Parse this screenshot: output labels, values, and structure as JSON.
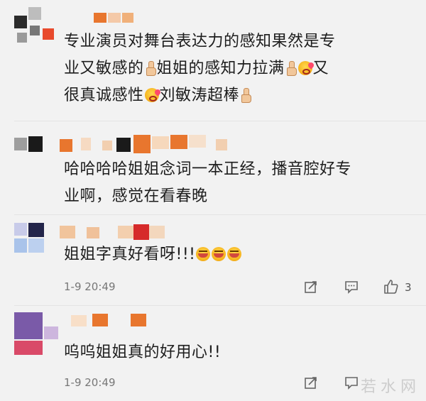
{
  "comments": [
    {
      "text_parts": {
        "l1": "专业演员对舞台表达力的感知果然是专",
        "l2a": "业又敏感的",
        "l2b": "姐姐的感知力拉满",
        "l2c": "又",
        "l3a": "很真诚感性",
        "l3b": "刘敏涛超棒"
      }
    },
    {
      "text_parts": {
        "l1": "哈哈哈哈姐姐念词一本正经，播音腔好专",
        "l2": "业啊，感觉在看春晚"
      }
    },
    {
      "text_parts": {
        "l1": "姐姐字真好看呀!!!"
      },
      "date": "1-9 20:49",
      "like_count": "3"
    },
    {
      "text_parts": {
        "l1": "呜呜姐姐真的好用心!!"
      },
      "date": "1-9 20:49"
    }
  ],
  "icons": {
    "share": "share-icon",
    "comment": "comment-icon",
    "like": "thumbs-up-icon"
  },
  "watermark": "若水网",
  "colors": {
    "background": "#f2f2f2",
    "text": "#1d1d1d",
    "meta": "#777777"
  }
}
